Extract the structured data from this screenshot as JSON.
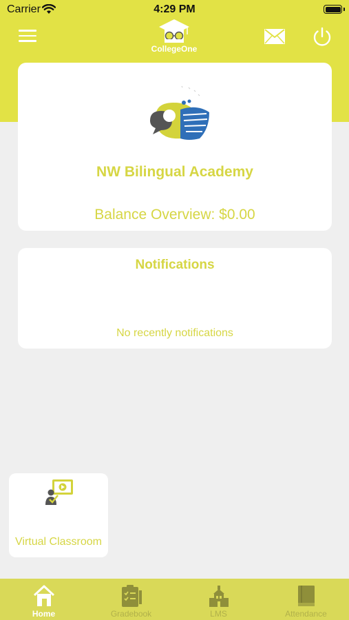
{
  "status_bar": {
    "carrier": "Carrier",
    "time": "4:29 PM"
  },
  "header": {
    "logo_text": "CollegeOne",
    "icons": {
      "menu": "hamburger-menu-icon",
      "mail": "envelope-icon",
      "power": "power-icon"
    }
  },
  "school": {
    "name": "NW Bilingual Academy",
    "balance": "Balance Overview: $0.00"
  },
  "notifications": {
    "title": "Notifications",
    "empty_message": "No recently notifications"
  },
  "shortcuts": [
    {
      "label": "Virtual Classroom",
      "icon": "virtual-classroom-icon"
    }
  ],
  "tabs": [
    {
      "label": "Home",
      "icon": "home-icon",
      "active": true
    },
    {
      "label": "Gradebook",
      "icon": "gradebook-icon",
      "active": false
    },
    {
      "label": "LMS",
      "icon": "lms-icon",
      "active": false
    },
    {
      "label": "Attendance",
      "icon": "attendance-icon",
      "active": false
    }
  ],
  "colors": {
    "accent": "#e2e245",
    "text_accent": "#d6d644",
    "tab_bar": "#d9d958",
    "background": "#efefef"
  }
}
